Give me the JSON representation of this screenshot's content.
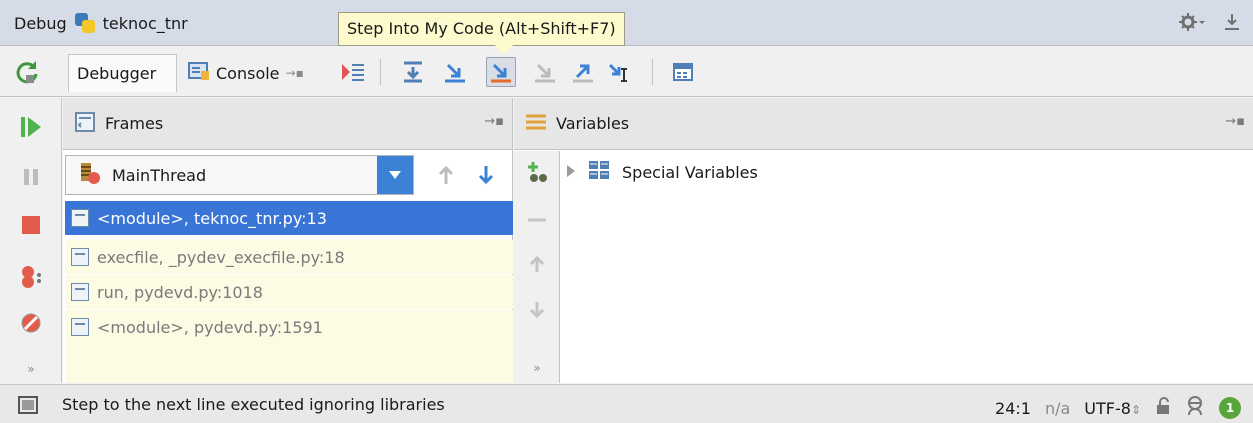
{
  "titlebar": {
    "label": "Debug",
    "config_name": "teknoc_tnr"
  },
  "tooltip": {
    "text": "Step Into My Code (Alt+Shift+F7)"
  },
  "tabs": {
    "debugger": "Debugger",
    "console": "Console"
  },
  "frames": {
    "header": "Frames",
    "thread": "MainThread",
    "rows": [
      {
        "text": "<module>, teknoc_tnr.py:13"
      },
      {
        "text": "execfile, _pydev_execfile.py:18"
      },
      {
        "text": "run, pydevd.py:1018"
      },
      {
        "text": "<module>, pydevd.py:1591"
      }
    ]
  },
  "variables": {
    "header": "Variables",
    "rows": [
      {
        "text": "Special Variables"
      }
    ]
  },
  "status": {
    "message": "Step to the next line executed ignoring libraries",
    "position": "24:1",
    "na": "n/a",
    "encoding": "UTF-8",
    "notifications": "1"
  },
  "colors": {
    "accent": "#3875d7",
    "tooltip_bg": "#fdfbcd",
    "library_frame_bg": "#fcfce5",
    "stop_red": "#e35b4c",
    "resume_green": "#4fb24f"
  },
  "icons": {
    "toolbar": [
      "show-execution-point-icon",
      "step-over-icon",
      "step-into-icon",
      "step-into-my-code-icon",
      "force-step-into-icon",
      "step-out-icon",
      "run-to-cursor-icon",
      "evaluate-expression-icon"
    ],
    "left": [
      "resume-icon",
      "pause-icon",
      "stop-icon",
      "view-breakpoints-icon",
      "mute-breakpoints-icon",
      "more-icon"
    ]
  }
}
